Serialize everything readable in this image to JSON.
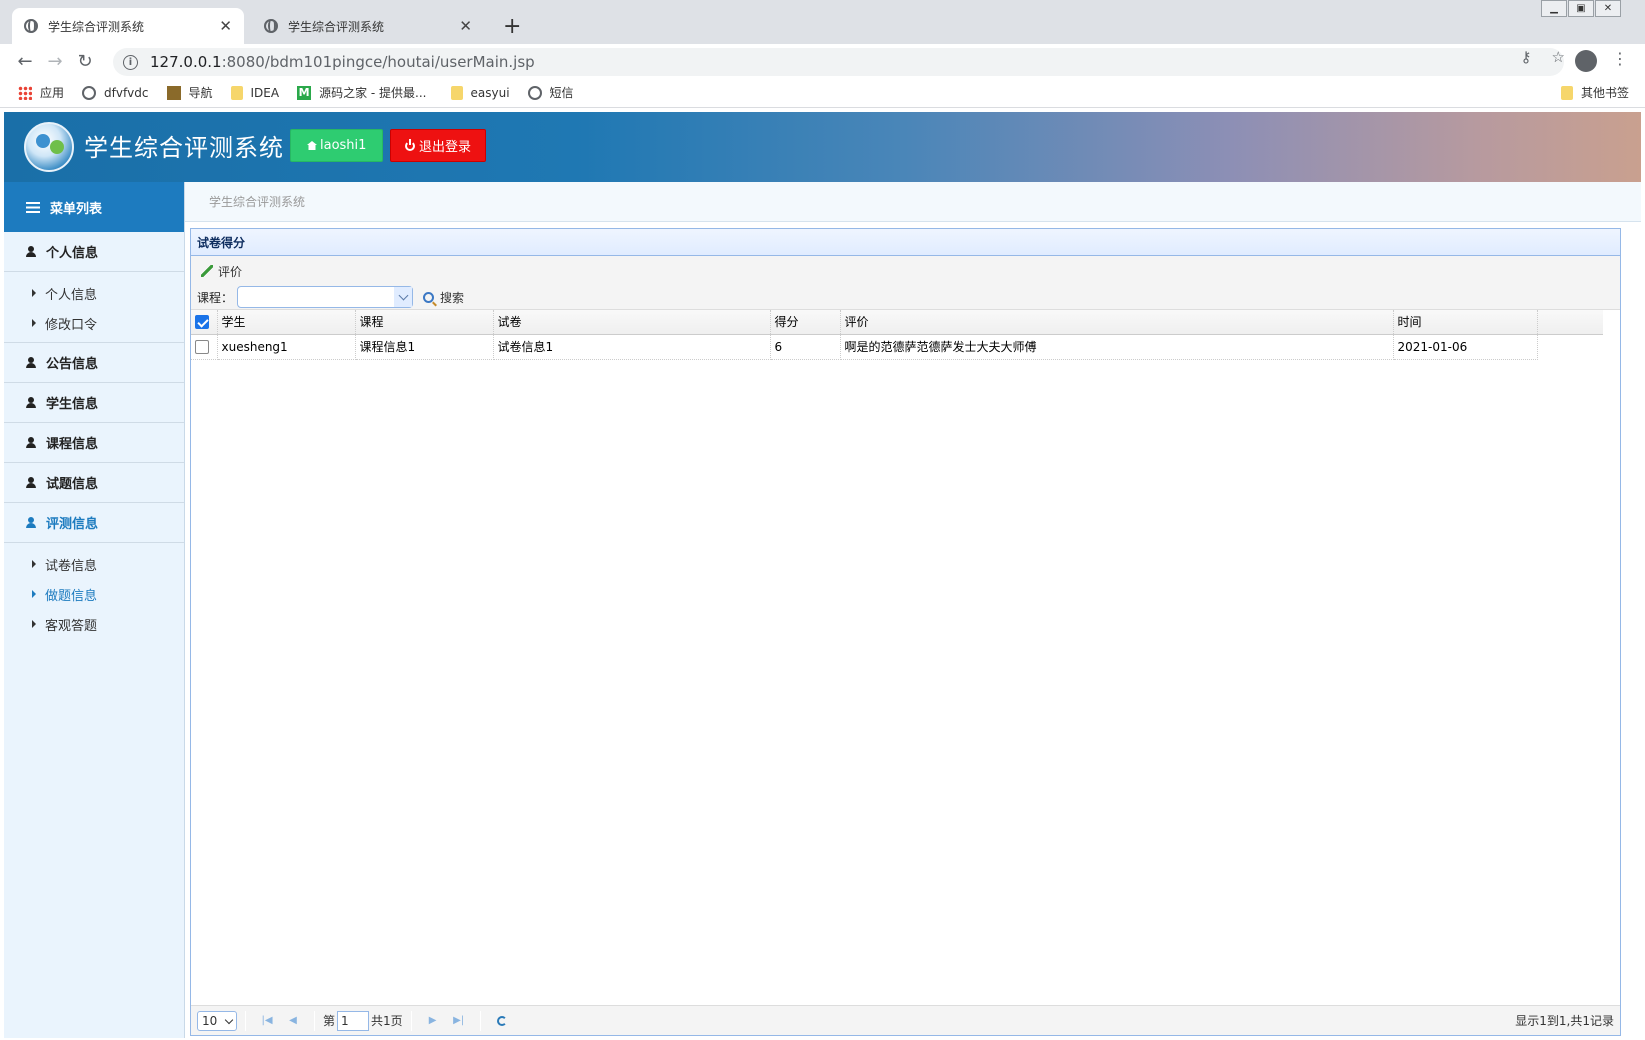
{
  "browser": {
    "tabs": [
      {
        "title": "学生综合评测系统",
        "close": "✕"
      },
      {
        "title": "学生综合评测系统",
        "close": "✕"
      }
    ],
    "new_tab": "+",
    "url_host": "127.0.0.1",
    "url_rest": ":8080/bdm101pingce/houtai/userMain.jsp",
    "bookmarks": [
      {
        "label": "应用",
        "icon": "apps-icon"
      },
      {
        "label": "dfvfvdc",
        "icon": "globe-icon"
      },
      {
        "label": "导航",
        "icon": "nav-icon"
      },
      {
        "label": "IDEA",
        "icon": "folder-icon"
      },
      {
        "label": "源码之家 - 提供最...",
        "icon": "m-icon"
      },
      {
        "label": "easyui",
        "icon": "folder-icon"
      },
      {
        "label": "短信",
        "icon": "globe-icon"
      }
    ],
    "other_bookmarks": "其他书签"
  },
  "header": {
    "app_title": "学生综合评测系统",
    "user_button": "laoshi1",
    "logout_button": "退出登录"
  },
  "sidebar": {
    "menu_title": "菜单列表",
    "groups": [
      {
        "label": "个人信息"
      },
      {
        "label": "公告信息"
      },
      {
        "label": "学生信息"
      },
      {
        "label": "课程信息"
      },
      {
        "label": "试题信息"
      },
      {
        "label": "评测信息"
      }
    ],
    "personal_sub": [
      "个人信息",
      "修改口令"
    ],
    "eval_sub": [
      "试卷信息",
      "做题信息",
      "客观答题"
    ]
  },
  "breadcrumb": "学生综合评测系统",
  "panel": {
    "title": "试卷得分",
    "toolbar": {
      "evaluate": "评价",
      "course_label": "课程：",
      "course_value": "",
      "search": "搜索"
    },
    "columns": [
      "学生",
      "课程",
      "试卷",
      "得分",
      "评价",
      "时间"
    ],
    "rows": [
      {
        "student": "xuesheng1",
        "course": "课程信息1",
        "paper": "试卷信息1",
        "score": "6",
        "comment": "啊是的范德萨范德萨发士大夫大师傅",
        "time": "2021-01-06"
      }
    ],
    "pager": {
      "page_size": "10",
      "page_prefix": "第",
      "page_number": "1",
      "page_total": "共1页",
      "info": "显示1到1,共1记录"
    }
  },
  "colors": {
    "accent": "#1d7bbf",
    "user_button": "#2ecc71",
    "logout_button": "#ee1111"
  }
}
